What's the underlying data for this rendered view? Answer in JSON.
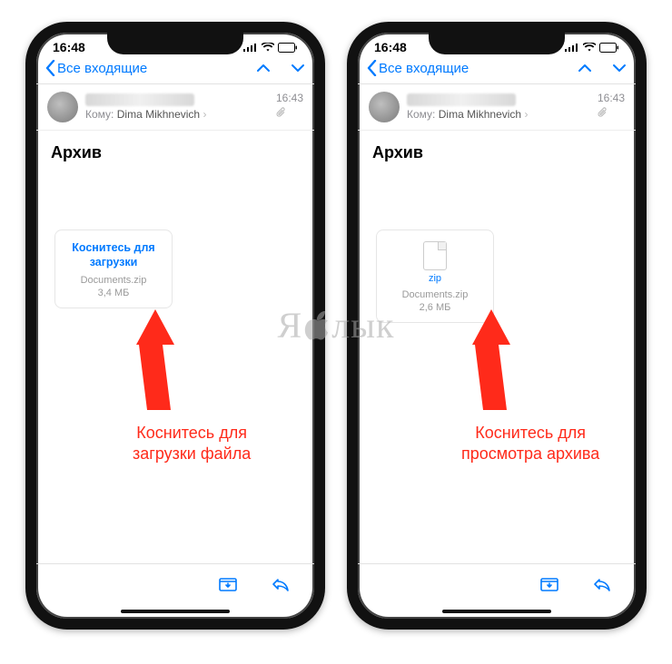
{
  "watermark": "Я лык",
  "phones": [
    {
      "status_time": "16:48",
      "back_label": "Все входящие",
      "to_label": "Кому:",
      "to_name": "Dima Mikhnevich",
      "msg_time": "16:43",
      "subject": "Архив",
      "attachment": {
        "tap_label": "Коснитесь для загрузки",
        "filename": "Documents.zip",
        "size": "3,4 МБ",
        "show_icon": false
      },
      "caption": "Коснитесь для\nзагрузки файла"
    },
    {
      "status_time": "16:48",
      "back_label": "Все входящие",
      "to_label": "Кому:",
      "to_name": "Dima Mikhnevich",
      "msg_time": "16:43",
      "subject": "Архив",
      "attachment": {
        "ext_label": "zip",
        "filename": "Documents.zip",
        "size": "2,6 МБ",
        "show_icon": true
      },
      "caption": "Коснитесь для\nпросмотра архива"
    }
  ]
}
